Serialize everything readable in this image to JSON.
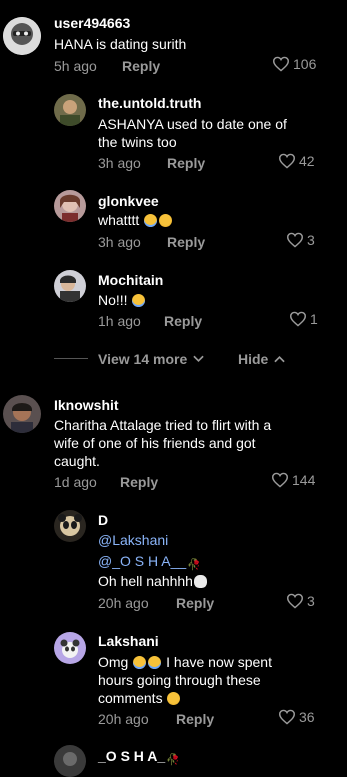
{
  "comments": [
    {
      "user": "user494663",
      "text": "HANA is dating surith",
      "time": "5h ago",
      "reply_label": "Reply",
      "likes": "106"
    },
    {
      "user": "the.untold.truth",
      "text_line1": "ASHANYA used to date one of",
      "text_line2": "the twins too",
      "time": "3h ago",
      "reply_label": "Reply",
      "likes": "42"
    },
    {
      "user": "glonkvee",
      "text": "whatttt",
      "time": "3h ago",
      "reply_label": "Reply",
      "likes": "3"
    },
    {
      "user": "Mochitain",
      "text": "No!!!",
      "time": "1h ago",
      "reply_label": "Reply",
      "likes": "1"
    },
    {
      "user": "Iknowshit",
      "text_line1": "Charitha Attalage tried to flirt with a",
      "text_line2": "wife of one of his friends and got",
      "text_line3": "caught.",
      "time": "1d ago",
      "reply_label": "Reply",
      "likes": "144"
    },
    {
      "user": "D",
      "mention1": "@Lakshani",
      "mention2": "@_O S H A__",
      "text": "Oh hell nahhhh",
      "time": "20h ago",
      "reply_label": "Reply",
      "likes": "3"
    },
    {
      "user": "Lakshani",
      "text_line1_a": "Omg",
      "text_line1_b": "I have now spent",
      "text_line2": "hours going through these",
      "text_line3": "comments",
      "time": "20h ago",
      "reply_label": "Reply",
      "likes": "36"
    },
    {
      "user": "_O S H A_"
    }
  ],
  "thread": {
    "view_more_label": "View 14 more",
    "hide_label": "Hide"
  },
  "icons": {
    "like": "heart-outline-icon",
    "chevron_down": "chevron-down-icon",
    "chevron_up": "chevron-up-icon"
  },
  "colors": {
    "background": "#000000",
    "secondary_text": "#9a9a9a",
    "mention": "#8ab4f8"
  }
}
